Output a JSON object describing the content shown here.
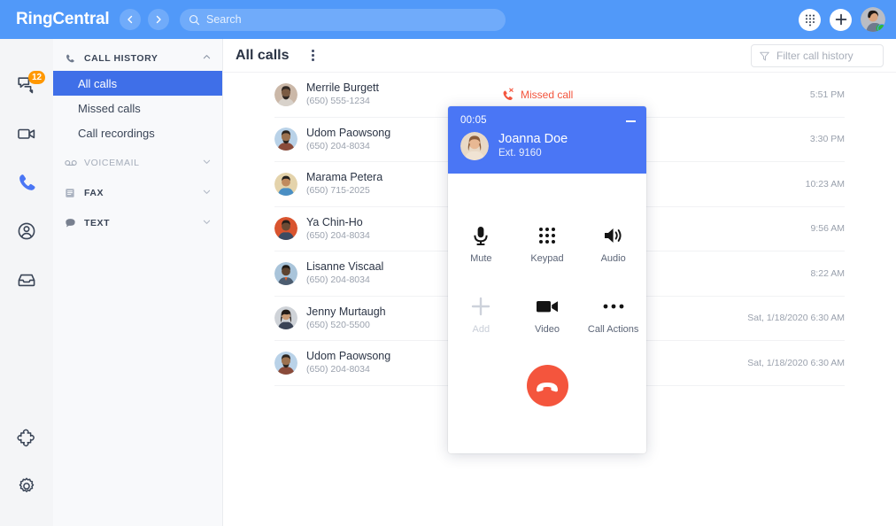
{
  "app": {
    "brand": "RingCentral",
    "accent_header": "#5199f9",
    "accent_call_panel": "#4a76f5",
    "accent_selected": "#3f6fe8",
    "accent_danger": "#f4553d",
    "accent_badge": "#ff9800",
    "accent_presence": "#2eb83d"
  },
  "header": {
    "back_icon": "chevron-left-icon",
    "forward_icon": "chevron-right-icon",
    "search": {
      "placeholder": "Search",
      "value": "",
      "icon": "search-icon"
    },
    "dialpad_icon": "dialpad-icon",
    "add_icon": "plus-icon",
    "avatar_icon": "user-avatar",
    "presence_status": "online"
  },
  "rail": {
    "items": [
      {
        "name": "message",
        "icon": "message-icon",
        "badge": "12",
        "active": false
      },
      {
        "name": "video",
        "icon": "video-camera-icon",
        "badge": "",
        "active": false
      },
      {
        "name": "phone",
        "icon": "phone-icon",
        "badge": "",
        "active": true
      },
      {
        "name": "contacts",
        "icon": "contacts-icon",
        "badge": "",
        "active": false
      },
      {
        "name": "inbox",
        "icon": "inbox-icon",
        "badge": "",
        "active": false
      }
    ],
    "bottom_items": [
      {
        "name": "apps",
        "icon": "puzzle-piece-icon"
      },
      {
        "name": "settings",
        "icon": "gear-icon"
      }
    ]
  },
  "sidebar": {
    "sections": [
      {
        "label": "Call History",
        "icon": "phone-icon",
        "expanded": true,
        "chevron": "chevron-up-icon",
        "style": "dark",
        "items": [
          {
            "label": "All calls",
            "active": true
          },
          {
            "label": "Missed calls",
            "active": false
          },
          {
            "label": "Call recordings",
            "active": false
          }
        ]
      },
      {
        "label": "Voicemail",
        "icon": "voicemail-icon",
        "expanded": false,
        "chevron": "chevron-down-icon",
        "style": "muted",
        "items": []
      },
      {
        "label": "Fax",
        "icon": "fax-icon",
        "expanded": false,
        "chevron": "chevron-down-icon",
        "style": "dark",
        "items": []
      },
      {
        "label": "Text",
        "icon": "text-bubble-icon",
        "expanded": false,
        "chevron": "chevron-down-icon",
        "style": "dark",
        "items": []
      }
    ]
  },
  "main": {
    "title": "All calls",
    "kebab_icon": "more-vertical-icon",
    "filter": {
      "placeholder": "Filter call history",
      "value": "",
      "icon": "funnel-icon"
    },
    "calls": [
      {
        "name": "Merrile Burgett",
        "phone": "(650) 555-1234",
        "status": "Missed call",
        "status_icon": "phone-missed-icon",
        "time": "5:51 PM",
        "avatar_bg": "#cbb8a8",
        "avatar_skin": "#7a5a42",
        "avatar_hair": "#2f2722",
        "avatar_shirt": "#d8d2cb"
      },
      {
        "name": "Udom Paowsong",
        "phone": "(650) 204-8034",
        "status": "",
        "status_icon": "",
        "time": "3:30 PM",
        "avatar_bg": "#b9d2e8",
        "avatar_skin": "#9c7250",
        "avatar_hair": "#2b241f",
        "avatar_shirt": "#8a4b3a"
      },
      {
        "name": "Marama Petera",
        "phone": "(650) 715-2025",
        "status": "",
        "status_icon": "",
        "time": "10:23 AM",
        "avatar_bg": "#e4d3ab",
        "avatar_skin": "#c08a5e",
        "avatar_hair": "#23201d",
        "avatar_shirt": "#4a8fc4"
      },
      {
        "name": "Ya Chin-Ho",
        "phone": "(650) 204-8034",
        "status": "",
        "status_icon": "",
        "time": "9:56 AM",
        "avatar_bg": "#d9542f",
        "avatar_skin": "#6b4a34",
        "avatar_hair": "#241d18",
        "avatar_shirt": "#3c4b63"
      },
      {
        "name": "Lisanne Viscaal",
        "phone": "(650) 204-8034",
        "status": "",
        "status_icon": "",
        "time": "8:22 AM",
        "avatar_bg": "#a9c4da",
        "avatar_skin": "#5d4330",
        "avatar_hair": "#1d1814",
        "avatar_shirt": "#4c5d70"
      },
      {
        "name": "Jenny Murtaugh",
        "phone": "(650) 520-5500",
        "status": "",
        "status_icon": "",
        "time": "Sat, 1/18/2020 6:30 AM",
        "avatar_bg": "#cfd3d8",
        "avatar_skin": "#c99a74",
        "avatar_hair": "#241c18",
        "avatar_shirt": "#3a4355"
      },
      {
        "name": "Udom Paowsong",
        "phone": "(650) 204-8034",
        "status": "",
        "status_icon": "",
        "time": "Sat, 1/18/2020 6:30 AM",
        "avatar_bg": "#b9d2e8",
        "avatar_skin": "#9c7250",
        "avatar_hair": "#2b241f",
        "avatar_shirt": "#8a4b3a"
      }
    ]
  },
  "call_panel": {
    "timer": "00:05",
    "minimize_icon": "minimize-icon",
    "caller_name": "Joanna Doe",
    "caller_ext": "Ext. 9160",
    "caller_avatar_icon": "caller-avatar",
    "actions": [
      {
        "label": "Mute",
        "icon": "microphone-icon",
        "disabled": false
      },
      {
        "label": "Keypad",
        "icon": "dialpad-icon",
        "disabled": false
      },
      {
        "label": "Audio",
        "icon": "speaker-icon",
        "disabled": false
      },
      {
        "label": "Add",
        "icon": "plus-icon",
        "disabled": true
      },
      {
        "label": "Video",
        "icon": "video-camera-icon",
        "disabled": false
      },
      {
        "label": "Call Actions",
        "icon": "ellipsis-icon",
        "disabled": false
      }
    ],
    "hangup_icon": "hangup-icon"
  }
}
